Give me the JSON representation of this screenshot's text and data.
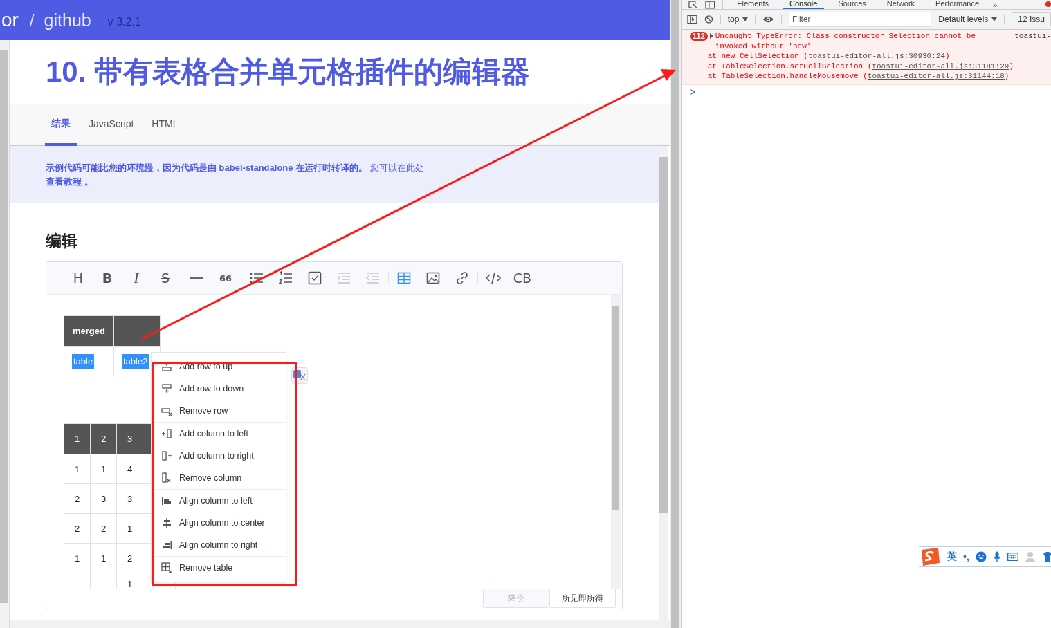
{
  "header": {
    "brand": "or",
    "separator": "/",
    "link": "github",
    "version": "v 3.2.1"
  },
  "title": "10. 带有表格合并单元格插件的编辑器",
  "tabs": [
    {
      "label": "结果",
      "selected": true
    },
    {
      "label": "JavaScript",
      "selected": false
    },
    {
      "label": "HTML",
      "selected": false
    }
  ],
  "notice": {
    "text": "示例代码可能比您的环境慢，因为代码是由 babel-standalone 在运行时转译的。",
    "link": "您可以在此处",
    "after": "查看教程 。"
  },
  "section_heading": "编辑",
  "editor": {
    "toolbar": [
      [
        {
          "kind": "heading",
          "label": "H",
          "disabled": false,
          "active": false
        },
        {
          "kind": "bold",
          "label": "B",
          "disabled": false,
          "active": false
        },
        {
          "kind": "italic",
          "label": "I",
          "disabled": false,
          "active": false
        },
        {
          "kind": "strike",
          "label": "S",
          "disabled": false,
          "active": false
        }
      ],
      [
        {
          "kind": "hr",
          "disabled": false,
          "active": false
        },
        {
          "kind": "quote",
          "label": "66",
          "disabled": false,
          "active": false
        }
      ],
      [
        {
          "kind": "ul",
          "disabled": false,
          "active": false
        },
        {
          "kind": "ol",
          "disabled": false,
          "active": false
        },
        {
          "kind": "task",
          "disabled": false,
          "active": false
        },
        {
          "kind": "indent",
          "disabled": true,
          "active": false
        },
        {
          "kind": "outdent",
          "disabled": true,
          "active": false
        }
      ],
      [
        {
          "kind": "table",
          "disabled": false,
          "active": true
        },
        {
          "kind": "image",
          "disabled": false,
          "active": false
        },
        {
          "kind": "link",
          "disabled": false,
          "active": false
        }
      ],
      [
        {
          "kind": "code",
          "disabled": false,
          "active": false
        },
        {
          "kind": "codeblock",
          "label": "CB",
          "disabled": false,
          "active": false
        }
      ]
    ],
    "table_1": {
      "header": [
        "merged"
      ],
      "rows": [
        [
          {
            "text": "table",
            "selected": true
          },
          {
            "text": "table2",
            "selected": true
          }
        ]
      ]
    },
    "table_2": {
      "header": [
        "1",
        "2",
        "3"
      ],
      "rows": [
        {
          "column_1": "1",
          "column_2": "1",
          "column_3": "4"
        },
        {
          "column_1": "2",
          "column_2": "3",
          "column_3": "3"
        },
        {
          "column_1": "2",
          "column_2": "2",
          "column_3": "1"
        },
        {
          "column_1": "1",
          "column_2": "1",
          "column_3": "2"
        },
        {
          "column_3": "1"
        }
      ]
    },
    "context_menu": [
      [
        {
          "kind": "row-up",
          "label": "Add row to up"
        },
        {
          "kind": "row-down",
          "label": "Add row to down"
        },
        {
          "kind": "row-remove",
          "label": "Remove row"
        }
      ],
      [
        {
          "kind": "col-left",
          "label": "Add column to left"
        },
        {
          "kind": "col-right",
          "label": "Add column to right"
        },
        {
          "kind": "col-remove",
          "label": "Remove column"
        }
      ],
      [
        {
          "kind": "align-left",
          "label": "Align column to left"
        },
        {
          "kind": "align-center",
          "label": "Align column to center"
        },
        {
          "kind": "align-right",
          "label": "Align column to right"
        }
      ],
      [
        {
          "kind": "table-remove",
          "label": "Remove table"
        }
      ]
    ],
    "mode_tabs": [
      {
        "label": "降价",
        "selected": false
      },
      {
        "label": "所见即所得",
        "selected": true
      }
    ]
  },
  "devtools": {
    "tabs": [
      {
        "label": "Elements",
        "selected": false
      },
      {
        "label": "Console",
        "selected": true
      },
      {
        "label": "Sources",
        "selected": false
      },
      {
        "label": "Network",
        "selected": false
      },
      {
        "label": "Performance",
        "selected": false
      }
    ],
    "more": "»",
    "context": "top",
    "filter": {
      "placeholder": "Filter"
    },
    "levels": "Default levels",
    "issues": "12 Issu",
    "error": {
      "count": "112",
      "message": "Uncaught TypeError: Class constructor Selection cannot be invoked without 'new'",
      "source": "toastui-",
      "stack": [
        {
          "prefix": "at new CellSelection (",
          "link": "toastui-editor-all.js:30930:24",
          "suffix": ")"
        },
        {
          "prefix": "at TableSelection.setCellSelection (",
          "link": "toastui-editor-all.js:31181:29",
          "suffix": ")"
        },
        {
          "prefix": "at TableSelection.handleMousemove (",
          "link": "toastui-editor-all.js:31144:18",
          "suffix": ")"
        }
      ]
    },
    "prompt": ">"
  },
  "ime_bar": {
    "language": "英",
    "punctuation": "•,"
  }
}
